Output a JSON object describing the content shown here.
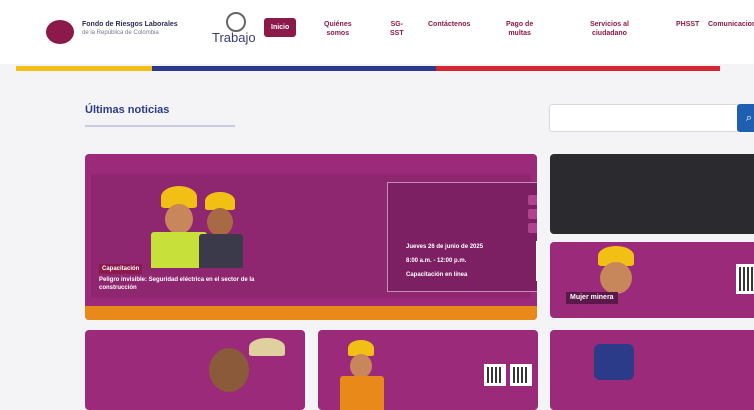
{
  "header": {
    "brand_title": "Fondo de Riesgos Laborales",
    "brand_subtitle": "de la República de Colombia",
    "ministry": "Trabajo"
  },
  "nav": {
    "items": [
      {
        "label": "Inicio",
        "active": true
      },
      {
        "label": "Quiénes\nsomos"
      },
      {
        "label": "SG-\nSST"
      },
      {
        "label": "Contáctenos"
      },
      {
        "label": "Pago de\nmultas"
      },
      {
        "label": "Servicios al\nciudadano"
      },
      {
        "label": "PHSST"
      },
      {
        "label": "Comunicaciones"
      }
    ]
  },
  "colors": {
    "brand": "#8b1a4a",
    "stripe_yellow": "#f2c014",
    "stripe_blue": "#2b3b8a",
    "stripe_red": "#d6262f",
    "accent_orange": "#e8891a"
  },
  "news": {
    "section_title": "Últimas noticias",
    "search_icon": "search-icon"
  },
  "main_card": {
    "tag": "Capacitación",
    "headline": "Peligro invisible: Seguridad eléctrica en el sector de la construcción",
    "date": "Jueves 26 de junio de 2025",
    "time": "8:00 a.m. - 12:00 p.m.",
    "place": "Capacitación en línea"
  },
  "side_card": {
    "headline": "Mujer minera"
  }
}
